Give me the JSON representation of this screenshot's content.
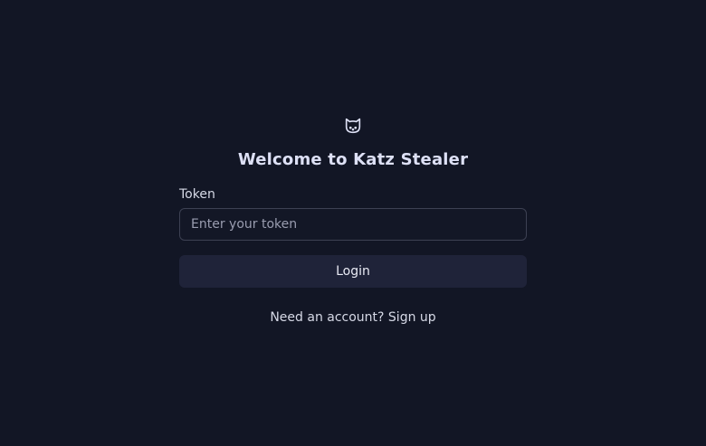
{
  "brand": {
    "icon": "cat-icon",
    "title": "Welcome to Katz Stealer"
  },
  "form": {
    "token_label": "Token",
    "token_placeholder": "Enter your token",
    "token_value": "",
    "login_label": "Login"
  },
  "footer": {
    "prompt": "Need an account?",
    "signup_label": "Sign up"
  },
  "colors": {
    "background": "#121625",
    "button": "#1f2339",
    "input_border": "#3d4153"
  }
}
